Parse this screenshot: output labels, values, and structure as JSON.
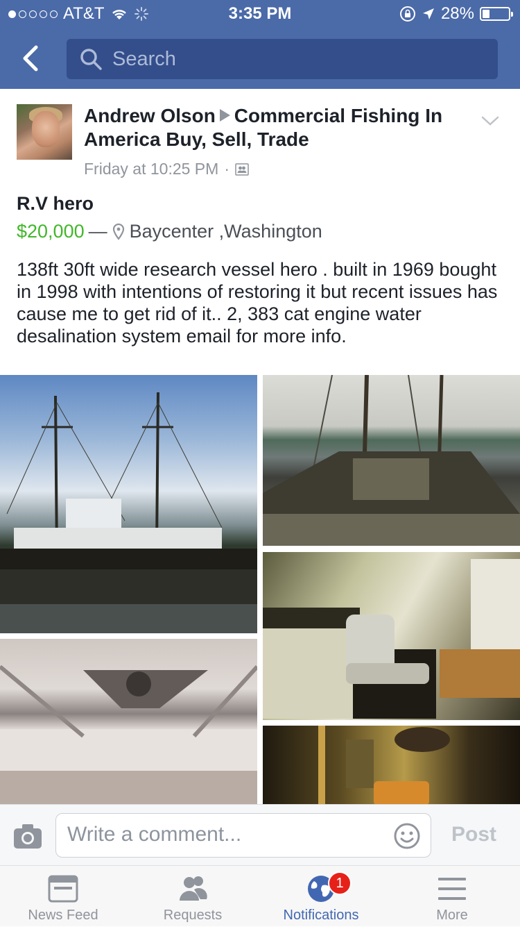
{
  "status_bar": {
    "carrier": "AT&T",
    "time": "3:35 PM",
    "battery": "28%",
    "battery_level": 0.28,
    "signal_bars": 1,
    "icons": [
      "wifi-icon",
      "activity-spinner-icon",
      "rotation-lock-icon",
      "location-arrow-icon",
      "battery-icon"
    ]
  },
  "header": {
    "search_placeholder": "Search",
    "color": "#4b6aa8"
  },
  "post": {
    "author": "Andrew Olson",
    "group": "Commercial Fishing In America Buy, Sell, Trade",
    "timestamp": "Friday at 10:25 PM",
    "timestamp_separator": "·",
    "audience_icon": "group-audience-icon",
    "title": "R.V hero",
    "price": "$20,000",
    "dash": "—",
    "location": "Baycenter ,Washington",
    "description": "138ft 30ft wide research vessel hero .  built in 1969 bought in 1998 with intentions of restoring it but recent issues has cause me to get rid of it.. 2, 383 cat engine water desalination system  email for more info.",
    "price_color": "#42b72a",
    "photos": 5
  },
  "comment_bar": {
    "placeholder": "Write a comment...",
    "post_label": "Post"
  },
  "tab_bar": {
    "tabs": [
      {
        "label": "News Feed",
        "icon": "news-feed-icon",
        "active": false
      },
      {
        "label": "Requests",
        "icon": "friend-requests-icon",
        "active": false
      },
      {
        "label": "Notifications",
        "icon": "globe-icon",
        "active": true,
        "badge": "1"
      },
      {
        "label": "More",
        "icon": "hamburger-menu-icon",
        "active": false
      }
    ],
    "active_color": "#4267b2"
  }
}
